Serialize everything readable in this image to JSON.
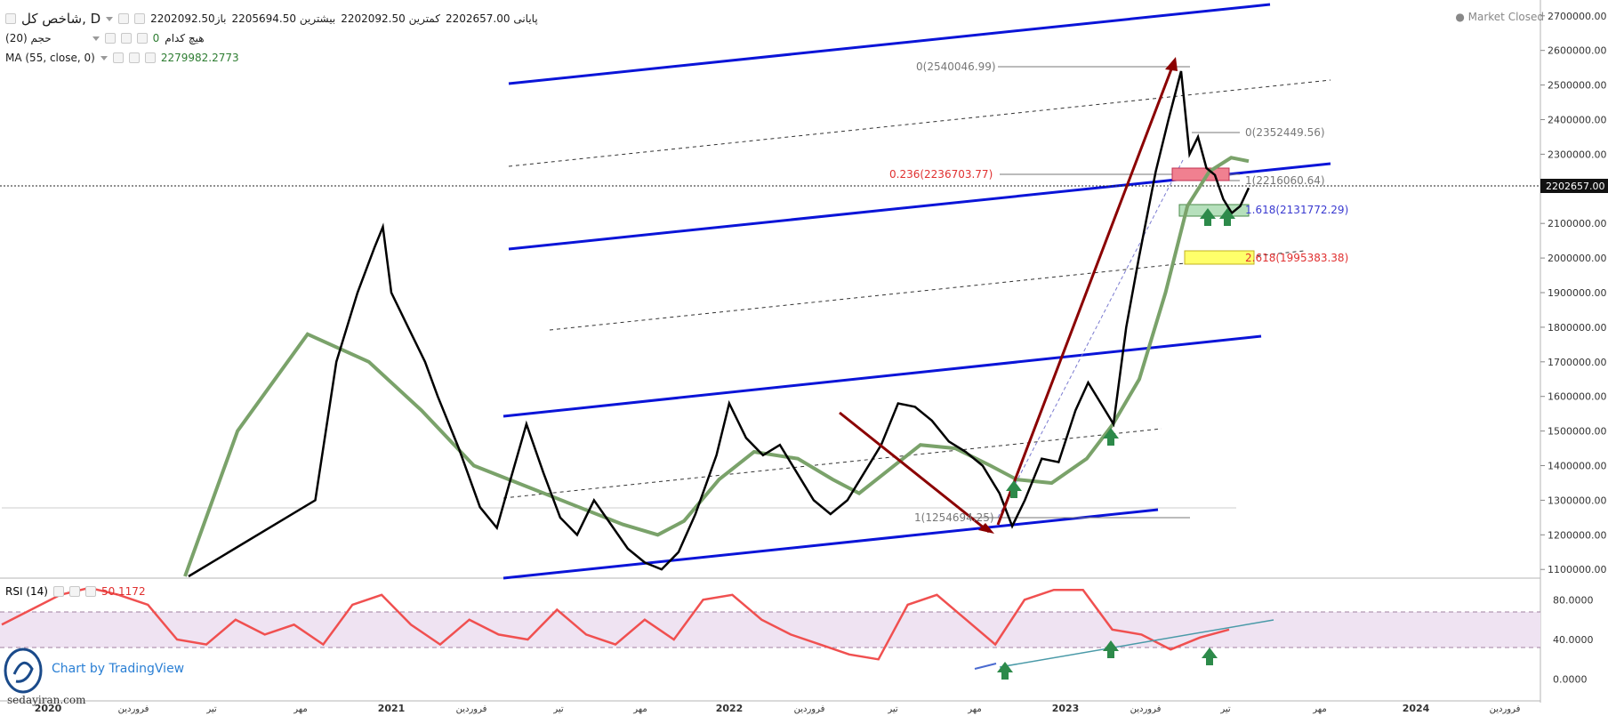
{
  "header": {
    "symbol": "شاخص کل, D",
    "open_label": "باز",
    "open": "2202092.50",
    "high_label": "بیشترین",
    "high": "2205694.50",
    "low_label": "کمترین",
    "low": "2202092.50",
    "close_label": "پایانی",
    "close": "2202657.00",
    "volume_label": "حجم (20)",
    "none_label": "هیچ کدام",
    "volume_value": "0",
    "ma_label": "MA (55, close, 0)",
    "ma_value": "2279982.2773",
    "market_status": "Market Closed"
  },
  "rsi": {
    "label": "RSI (14)",
    "value": "50.1172"
  },
  "branding": {
    "tradingview": "Chart by TradingView",
    "watermark": "sedayiran.com"
  },
  "colors": {
    "price": "#000000",
    "ma": "#7aa26a",
    "channel": "#0a14d8",
    "arrow": "#8b0000",
    "rsi": "#f05050",
    "rsi_band": "#efe3f2",
    "fib_red": "#e03030",
    "fib_blue": "#3a3ad0"
  },
  "chart_data": {
    "type": "line",
    "title": "شاخص کل, D",
    "x_ticks": [
      "2020",
      "فروردین",
      "تیر",
      "مهر",
      "2021",
      "فروردین",
      "تیر",
      "مهر",
      "2022",
      "فروردین",
      "تیر",
      "مهر",
      "2023",
      "فروردین",
      "تیر",
      "مهر",
      "2024",
      "فروردین"
    ],
    "y_ticks": [
      "2700000.00",
      "2600000.00",
      "2500000.00",
      "2400000.00",
      "2300000.00",
      "2200000.00",
      "2100000.00",
      "2000000.00",
      "1900000.00",
      "1800000.00",
      "1700000.00",
      "1600000.00",
      "1500000.00",
      "1400000.00",
      "1300000.00",
      "1200000.00",
      "1100000.00"
    ],
    "last_price_label": "2202657.00",
    "ylim": [
      1080000,
      2720000
    ],
    "series": [
      {
        "name": "شاخص کل",
        "points": [
          [
            0,
            1080000
          ],
          [
            3,
            1300000
          ],
          [
            3.5,
            1700000
          ],
          [
            4,
            1900000
          ],
          [
            4.4,
            2030000
          ],
          [
            4.6,
            2090000
          ],
          [
            4.8,
            1900000
          ],
          [
            5.2,
            1800000
          ],
          [
            5.6,
            1700000
          ],
          [
            5.9,
            1600000
          ],
          [
            6.4,
            1450000
          ],
          [
            6.9,
            1280000
          ],
          [
            7.3,
            1220000
          ],
          [
            7.6,
            1350000
          ],
          [
            8.0,
            1520000
          ],
          [
            8.4,
            1380000
          ],
          [
            8.8,
            1250000
          ],
          [
            9.2,
            1200000
          ],
          [
            9.6,
            1300000
          ],
          [
            10.0,
            1230000
          ],
          [
            10.4,
            1160000
          ],
          [
            10.8,
            1120000
          ],
          [
            11.2,
            1100000
          ],
          [
            11.6,
            1150000
          ],
          [
            12.0,
            1260000
          ],
          [
            12.5,
            1430000
          ],
          [
            12.8,
            1580000
          ],
          [
            13.2,
            1480000
          ],
          [
            13.6,
            1430000
          ],
          [
            14.0,
            1460000
          ],
          [
            14.4,
            1380000
          ],
          [
            14.8,
            1300000
          ],
          [
            15.2,
            1260000
          ],
          [
            15.6,
            1300000
          ],
          [
            16.0,
            1380000
          ],
          [
            16.4,
            1460000
          ],
          [
            16.8,
            1580000
          ],
          [
            17.2,
            1570000
          ],
          [
            17.6,
            1530000
          ],
          [
            18.0,
            1470000
          ],
          [
            18.4,
            1440000
          ],
          [
            18.8,
            1400000
          ],
          [
            19.2,
            1320000
          ],
          [
            19.5,
            1225000
          ],
          [
            19.8,
            1300000
          ],
          [
            20.2,
            1420000
          ],
          [
            20.6,
            1410000
          ],
          [
            21.0,
            1560000
          ],
          [
            21.3,
            1640000
          ],
          [
            21.6,
            1580000
          ],
          [
            21.9,
            1520000
          ],
          [
            22.2,
            1800000
          ],
          [
            22.5,
            2000000
          ],
          [
            22.9,
            2250000
          ],
          [
            23.2,
            2400000
          ],
          [
            23.5,
            2540000
          ],
          [
            23.7,
            2300000
          ],
          [
            23.9,
            2350000
          ],
          [
            24.1,
            2260000
          ],
          [
            24.3,
            2240000
          ],
          [
            24.5,
            2170000
          ],
          [
            24.7,
            2130000
          ],
          [
            24.9,
            2150000
          ],
          [
            25.1,
            2202657
          ]
        ]
      },
      {
        "name": "MA (55, close, 0)",
        "points": [
          [
            0.8,
            1080000
          ],
          [
            2,
            1500000
          ],
          [
            3.6,
            1780000
          ],
          [
            5.0,
            1700000
          ],
          [
            6.2,
            1560000
          ],
          [
            7.4,
            1400000
          ],
          [
            8.6,
            1340000
          ],
          [
            9.8,
            1280000
          ],
          [
            10.8,
            1230000
          ],
          [
            11.6,
            1200000
          ],
          [
            12.2,
            1240000
          ],
          [
            13.0,
            1360000
          ],
          [
            13.8,
            1440000
          ],
          [
            14.8,
            1420000
          ],
          [
            15.6,
            1360000
          ],
          [
            16.2,
            1320000
          ],
          [
            16.8,
            1380000
          ],
          [
            17.6,
            1460000
          ],
          [
            18.4,
            1450000
          ],
          [
            19.2,
            1400000
          ],
          [
            19.8,
            1360000
          ],
          [
            20.6,
            1350000
          ],
          [
            21.4,
            1420000
          ],
          [
            22.0,
            1520000
          ],
          [
            22.6,
            1650000
          ],
          [
            23.2,
            1900000
          ],
          [
            23.7,
            2150000
          ],
          [
            24.2,
            2250000
          ],
          [
            24.7,
            2290000
          ],
          [
            25.1,
            2280000
          ]
        ]
      },
      {
        "name": "RSI (14)",
        "points": [
          [
            0,
            55
          ],
          [
            1,
            70
          ],
          [
            2,
            85
          ],
          [
            3,
            92
          ],
          [
            4,
            85
          ],
          [
            5,
            75
          ],
          [
            6,
            40
          ],
          [
            7,
            35
          ],
          [
            8,
            60
          ],
          [
            9,
            45
          ],
          [
            10,
            55
          ],
          [
            11,
            35
          ],
          [
            12,
            75
          ],
          [
            13,
            85
          ],
          [
            14,
            55
          ],
          [
            15,
            35
          ],
          [
            16,
            60
          ],
          [
            17,
            45
          ],
          [
            18,
            40
          ],
          [
            19,
            70
          ],
          [
            20,
            45
          ],
          [
            21,
            35
          ],
          [
            22,
            60
          ],
          [
            23,
            40
          ],
          [
            24,
            80
          ],
          [
            25,
            85
          ],
          [
            26,
            60
          ],
          [
            27,
            45
          ],
          [
            28,
            35
          ],
          [
            29,
            25
          ],
          [
            30,
            20
          ],
          [
            31,
            75
          ],
          [
            32,
            85
          ],
          [
            33,
            60
          ],
          [
            34,
            35
          ],
          [
            35,
            80
          ],
          [
            36,
            90
          ],
          [
            37,
            90
          ],
          [
            38,
            50
          ],
          [
            39,
            45
          ],
          [
            40,
            30
          ],
          [
            41,
            42
          ],
          [
            42,
            50
          ]
        ]
      }
    ],
    "annotations": {
      "fib_top_a": "0(2540046.99)",
      "fib_top_b": "0(2352449.56)",
      "fib_0236": "0.236(2236703.77)",
      "fib_1a": "1(2216060.64)",
      "fib_1618": "1.618(2131772.29)",
      "fib_2618": "2.618(1995383.38)",
      "fib_1b": "1(1254694.25)"
    },
    "rsi_ticks": [
      "80.0000",
      "40.0000",
      "0.0000"
    ],
    "rsi_ylim": [
      -20,
      100
    ],
    "grid": false,
    "legend": "top-left"
  }
}
